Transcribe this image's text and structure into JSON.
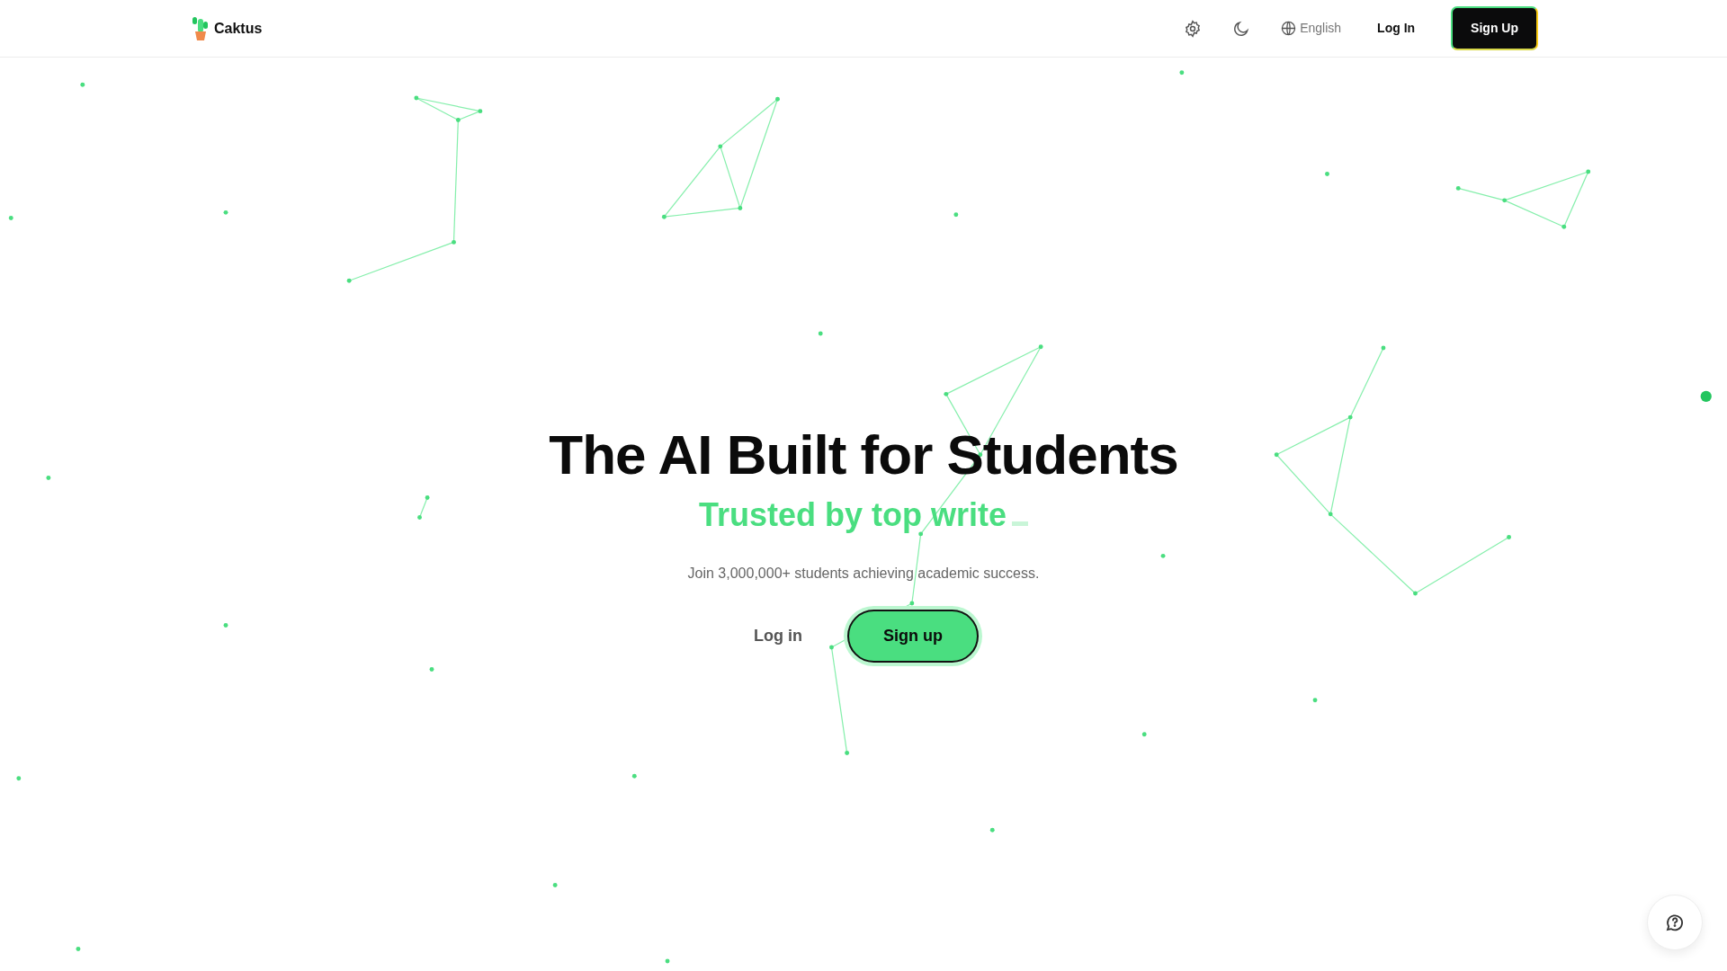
{
  "navbar": {
    "brand": "Caktus",
    "language": "English",
    "login": "Log In",
    "signup": "Sign Up"
  },
  "hero": {
    "title": "The AI Built for Students",
    "typed_text": "Trusted by top write",
    "subtitle": "Join 3,000,000+ students achieving academic success.",
    "login": "Log in",
    "signup": "Sign up"
  }
}
